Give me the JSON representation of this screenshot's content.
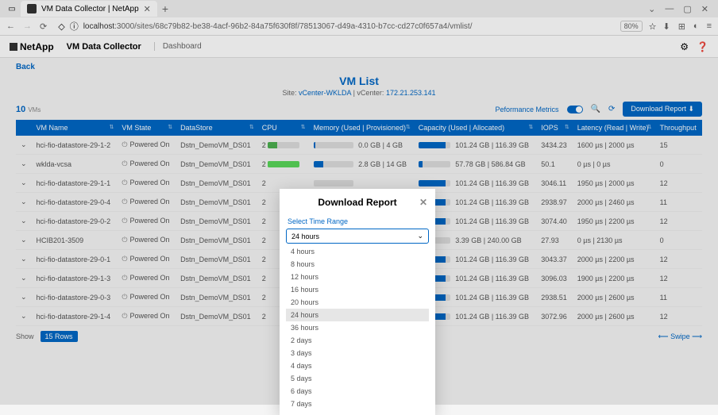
{
  "browser": {
    "tab_title": "VM Data Collector | NetApp",
    "url_prefix": "localhost",
    "url_rest": ":3000/sites/68c79b82-be38-4acf-96b2-84a75f630f8f/78513067-d49a-4310-b7cc-cd27c0f657a4/vmlist/",
    "zoom": "80%"
  },
  "header": {
    "brand": "NetApp",
    "app": "VM Data Collector",
    "crumb": "Dashboard"
  },
  "page": {
    "back": "Back",
    "title": "VM List",
    "site_label": "Site:",
    "site_name": "vCenter-WKLDA",
    "vcenter_label": "vCenter:",
    "vcenter_ip": "172.21.253.141",
    "count": "10",
    "count_unit": "VMs",
    "perf_label": "Peformance Metrics",
    "download": "Download Report"
  },
  "columns": [
    "",
    "VM Name",
    "VM State",
    "DataStore",
    "CPU",
    "Memory (Used | Provisioned)",
    "Capacity (Used | Allocated)",
    "IOPS",
    "Latency (Read | Write)",
    "Throughput"
  ],
  "rows": [
    {
      "name": "hci-fio-datastore-29-1-2",
      "state": "Powered On",
      "ds": "Dstn_DemoVM_DS01",
      "cpu": "2",
      "mem": "0.0 GB | 4 GB",
      "cap": "101.24 GB | 116.39 GB",
      "iops": "3434.23",
      "lat": "1600 µs | 2000 µs",
      "tp": "15"
    },
    {
      "name": "wklda-vcsa",
      "state": "Powered On",
      "ds": "Dstn_DemoVM_DS01",
      "cpu": "2",
      "mem": "2.8 GB | 14 GB",
      "cap": "57.78 GB | 586.84 GB",
      "iops": "50.1",
      "lat": "0 µs | 0 µs",
      "tp": "0"
    },
    {
      "name": "hci-fio-datastore-29-1-1",
      "state": "Powered On",
      "ds": "Dstn_DemoVM_DS01",
      "cpu": "2",
      "mem": "",
      "cap": "101.24 GB | 116.39 GB",
      "iops": "3046.11",
      "lat": "1950 µs | 2000 µs",
      "tp": "12"
    },
    {
      "name": "hci-fio-datastore-29-0-4",
      "state": "Powered On",
      "ds": "Dstn_DemoVM_DS01",
      "cpu": "2",
      "mem": "",
      "cap": "101.24 GB | 116.39 GB",
      "iops": "2938.97",
      "lat": "2000 µs | 2460 µs",
      "tp": "11"
    },
    {
      "name": "hci-fio-datastore-29-0-2",
      "state": "Powered On",
      "ds": "Dstn_DemoVM_DS01",
      "cpu": "2",
      "mem": "",
      "cap": "101.24 GB | 116.39 GB",
      "iops": "3074.40",
      "lat": "1950 µs | 2200 µs",
      "tp": "12"
    },
    {
      "name": "HCIB201-3509",
      "state": "Powered On",
      "ds": "Dstn_DemoVM_DS01",
      "cpu": "2",
      "mem": "",
      "cap": "3.39 GB | 240.00 GB",
      "iops": "27.93",
      "lat": "0 µs | 2130 µs",
      "tp": "0"
    },
    {
      "name": "hci-fio-datastore-29-0-1",
      "state": "Powered On",
      "ds": "Dstn_DemoVM_DS01",
      "cpu": "2",
      "mem": "",
      "cap": "101.24 GB | 116.39 GB",
      "iops": "3043.37",
      "lat": "2000 µs | 2200 µs",
      "tp": "12"
    },
    {
      "name": "hci-fio-datastore-29-1-3",
      "state": "Powered On",
      "ds": "Dstn_DemoVM_DS01",
      "cpu": "2",
      "mem": "",
      "cap": "101.24 GB | 116.39 GB",
      "iops": "3096.03",
      "lat": "1900 µs | 2200 µs",
      "tp": "12"
    },
    {
      "name": "hci-fio-datastore-29-0-3",
      "state": "Powered On",
      "ds": "Dstn_DemoVM_DS01",
      "cpu": "2",
      "mem": "",
      "cap": "101.24 GB | 116.39 GB",
      "iops": "2938.51",
      "lat": "2000 µs | 2600 µs",
      "tp": "11"
    },
    {
      "name": "hci-fio-datastore-29-1-4",
      "state": "Powered On",
      "ds": "Dstn_DemoVM_DS01",
      "cpu": "2",
      "mem": "",
      "cap": "101.24 GB | 116.39 GB",
      "iops": "3072.96",
      "lat": "2000 µs | 2600 µs",
      "tp": "12"
    }
  ],
  "footer": {
    "show": "Show",
    "rows": "15 Rows",
    "swipe": "Swipe"
  },
  "modal": {
    "title": "Download Report",
    "label": "Select Time Range",
    "selected": "24 hours",
    "options": [
      "4 hours",
      "8 hours",
      "12 hours",
      "16 hours",
      "20 hours",
      "24 hours",
      "36 hours",
      "2 days",
      "3 days",
      "4 days",
      "5 days",
      "6 days",
      "7 days"
    ]
  }
}
